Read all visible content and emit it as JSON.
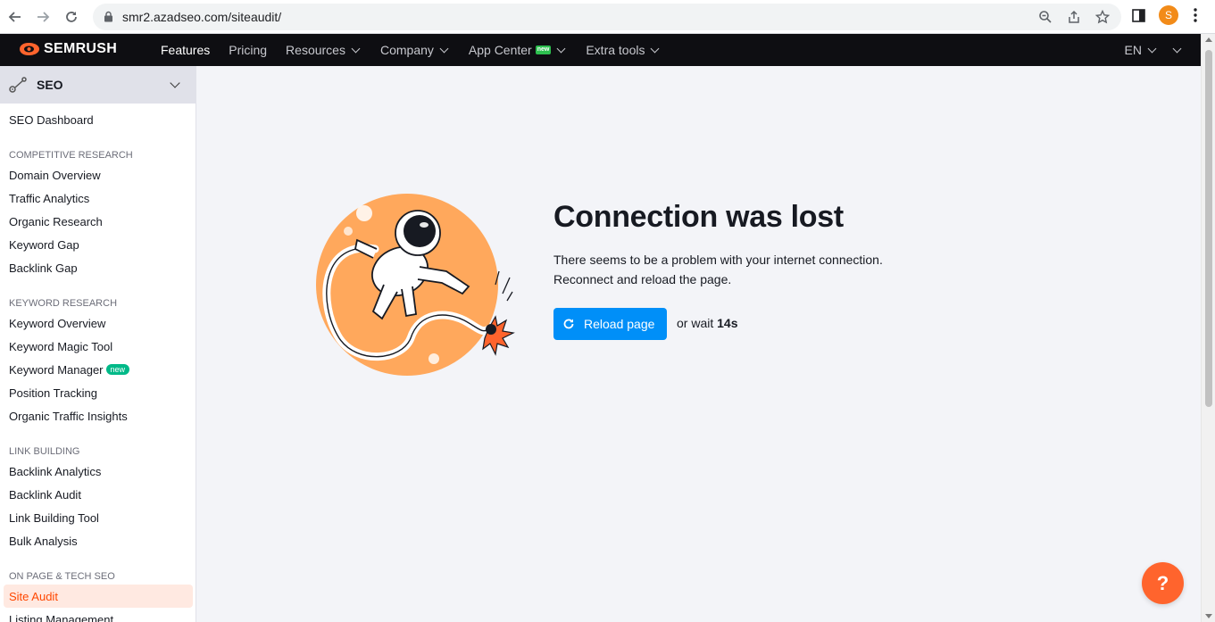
{
  "browser": {
    "url": "smr2.azadseo.com/siteaudit/",
    "profile_initial": "S"
  },
  "topnav": {
    "logo": "SEMRUSH",
    "items": [
      {
        "label": "Features"
      },
      {
        "label": "Pricing"
      },
      {
        "label": "Resources"
      },
      {
        "label": "Company"
      },
      {
        "label": "App Center",
        "badge": "new"
      },
      {
        "label": "Extra tools"
      }
    ],
    "language": "EN"
  },
  "sidebar": {
    "title": "SEO",
    "dashboard": "SEO Dashboard",
    "sections": [
      {
        "title": "COMPETITIVE RESEARCH",
        "items": [
          "Domain Overview",
          "Traffic Analytics",
          "Organic Research",
          "Keyword Gap",
          "Backlink Gap"
        ]
      },
      {
        "title": "KEYWORD RESEARCH",
        "items": [
          "Keyword Overview",
          "Keyword Magic Tool",
          "Keyword Manager",
          "Position Tracking",
          "Organic Traffic Insights"
        ]
      },
      {
        "title": "LINK BUILDING",
        "items": [
          "Backlink Analytics",
          "Backlink Audit",
          "Link Building Tool",
          "Bulk Analysis"
        ]
      },
      {
        "title": "ON PAGE & TECH SEO",
        "items": [
          "Site Audit",
          "Listing Management"
        ]
      }
    ],
    "keyword_manager_badge": "new"
  },
  "main": {
    "heading": "Connection was lost",
    "desc_line1": "There seems to be a problem with your internet connection.",
    "desc_line2": "Reconnect and reload the page.",
    "reload_label": "Reload page",
    "wait_prefix": "or wait",
    "wait_seconds": "14s"
  },
  "help": {
    "label": "?"
  },
  "colors": {
    "accent": "#ff642d",
    "button": "#008ff8",
    "nav_bg": "#0e0e12",
    "active_item": "#ff4700"
  },
  "icons": [
    "back-icon",
    "forward-icon",
    "reload-icon",
    "lock-icon",
    "zoom-icon",
    "share-icon",
    "star-icon",
    "sidepanel-icon",
    "kebab-icon",
    "seo-icon",
    "refresh-icon"
  ]
}
